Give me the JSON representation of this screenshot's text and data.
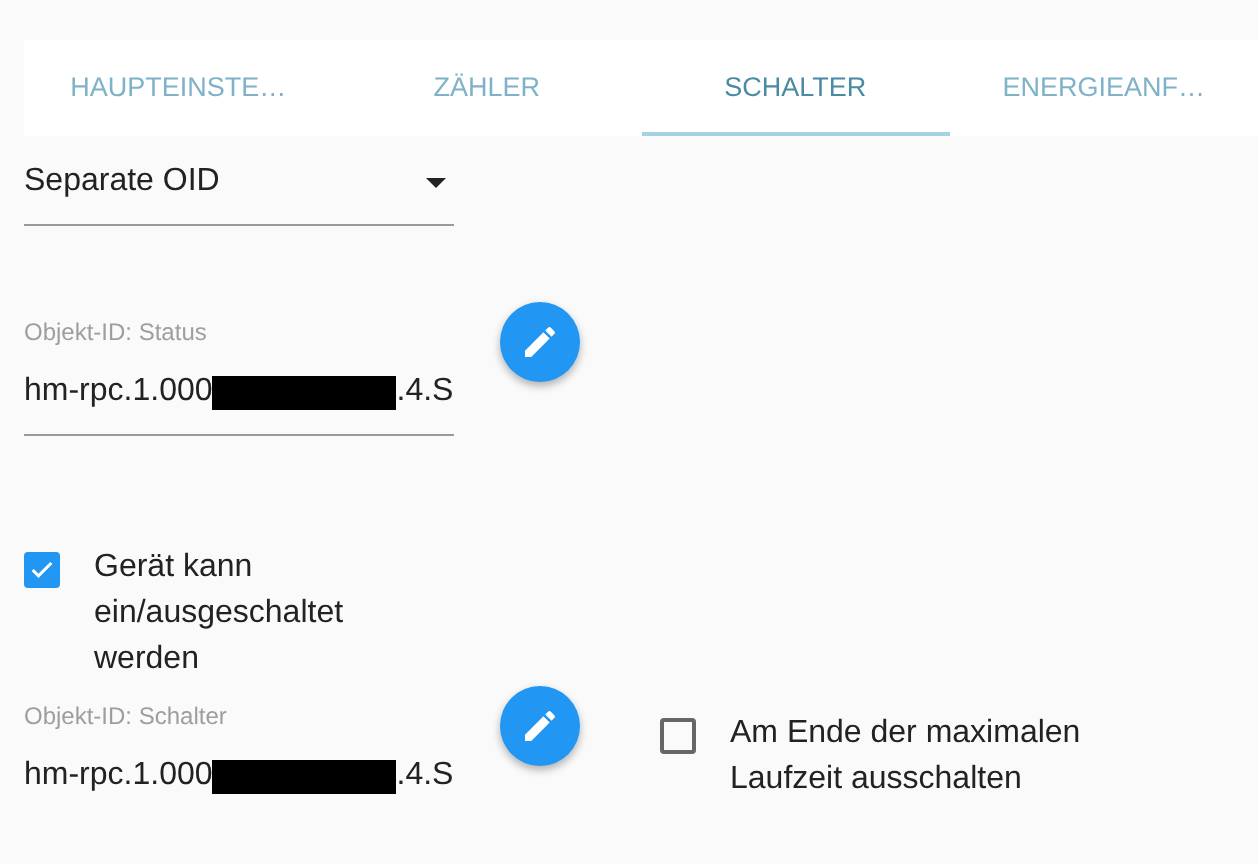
{
  "tabs": [
    {
      "label": "HAUPTEINSTE…",
      "selected": false
    },
    {
      "label": "ZÄHLER",
      "selected": false
    },
    {
      "label": "SCHALTER",
      "selected": true
    },
    {
      "label": "ENERGIEANF…",
      "selected": false
    }
  ],
  "mode_select": {
    "value": "Separate OID"
  },
  "status_field": {
    "label": "Objekt-ID: Status",
    "value_start": "hm-rpc.1.000",
    "value_end": ".4.S"
  },
  "switchable_checkbox": {
    "label": "Gerät kann ein/ausgeschaltet werden",
    "checked": true
  },
  "switch_field": {
    "label": "Objekt-ID: Schalter",
    "value_start": "hm-rpc.1.000",
    "value_end": ".4.S"
  },
  "max_runtime_checkbox": {
    "label": "Am Ende der maximalen Laufzeit ausschalten",
    "checked": false
  }
}
